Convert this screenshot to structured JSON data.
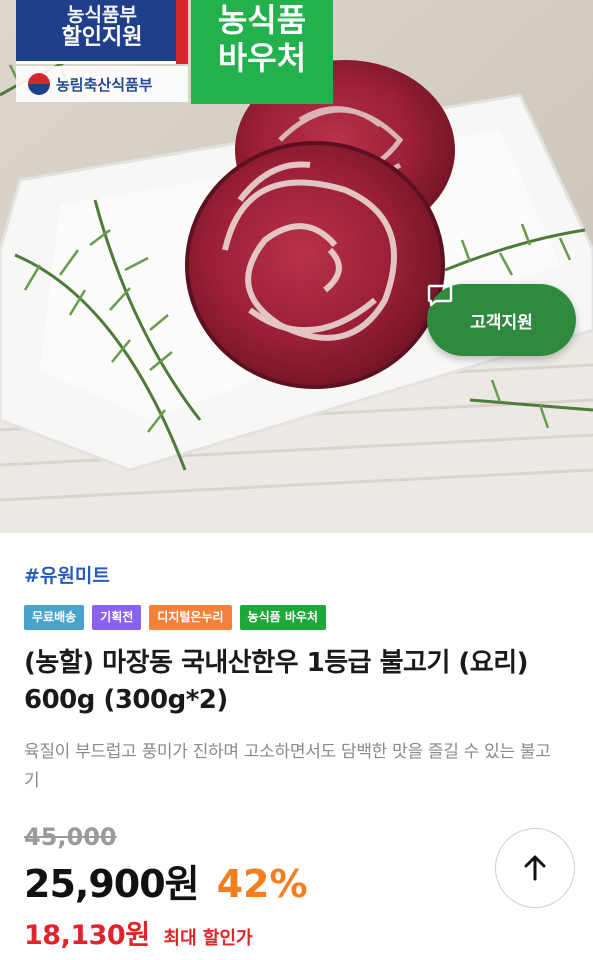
{
  "image_badges": {
    "gov_line1": "농식품부",
    "gov_line2": "할인지원",
    "ministry": "농림축산식품부",
    "voucher_line1": "농식품",
    "voucher_line2": "바우처"
  },
  "support_button": {
    "label": "고객지원",
    "icon": "chat-icon"
  },
  "product": {
    "brand": "#유원미트",
    "tags": [
      {
        "label": "무료배송",
        "color": "#4aa3c9"
      },
      {
        "label": "기획전",
        "color": "#8a62f0"
      },
      {
        "label": "디지털온누리",
        "color": "#f5823a"
      },
      {
        "label": "농식품 바우처",
        "color": "#1fa83a"
      }
    ],
    "title": "(농할) 마장동 국내산한우 1등급 불고기 (요리) 600g (300g*2)",
    "description": "육질이 부드럽고 풍미가 진하며 고소하면서도 담백한 맛을 즐길 수 있는 불고기",
    "original_price": "45,000",
    "price": "25,900원",
    "discount": "42%",
    "max_discount_price": "18,130원",
    "max_discount_label": "최대 할인가"
  },
  "scroll_top_button": {
    "icon": "arrow-up-icon"
  }
}
